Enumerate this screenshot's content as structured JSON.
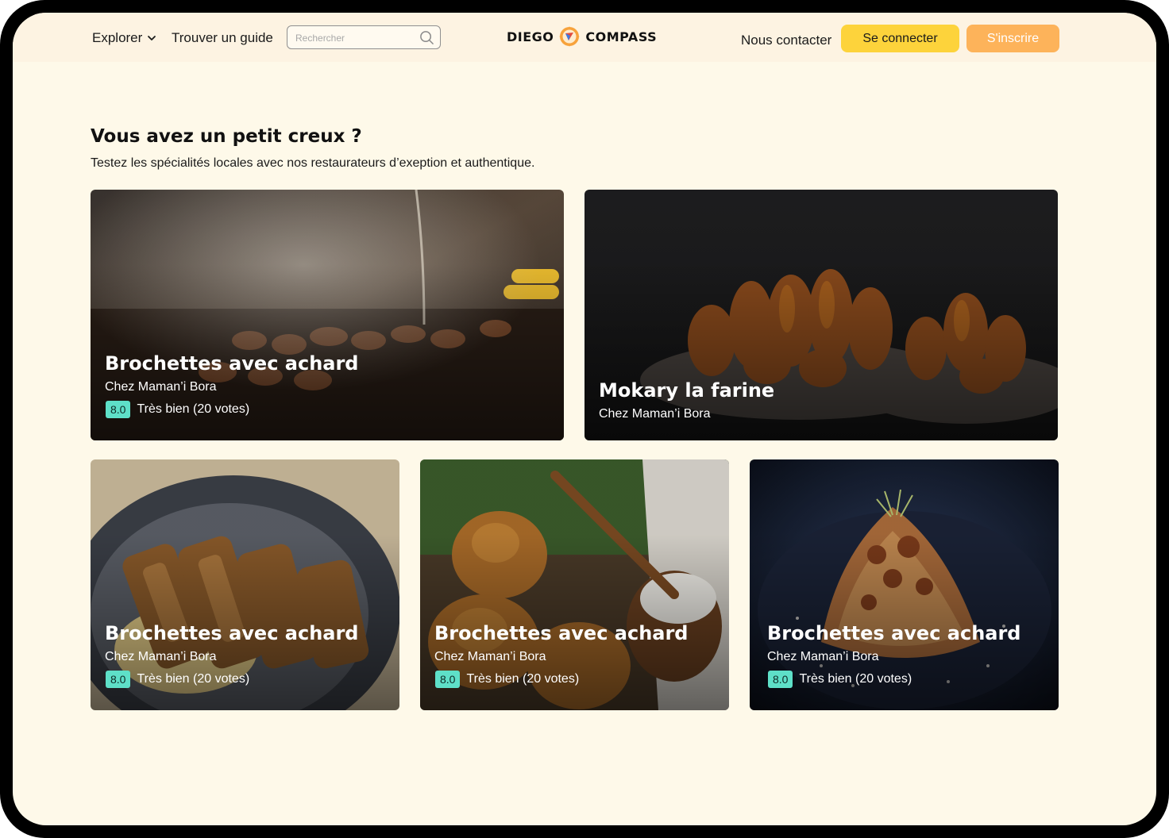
{
  "nav": {
    "explorer_label": "Explorer",
    "find_guide_label": "Trouver un guide",
    "search_placeholder": "Rechercher",
    "logo_left": "DIEGO",
    "logo_right": "COMPASS",
    "contact_label": "Nous contacter",
    "login_label": "Se connecter",
    "signup_label": "S'inscrire"
  },
  "section": {
    "title": "Vous avez un petit creux ?",
    "subtitle": "Testez les spécialités locales avec nos restaurateurs d’exeption et authentique."
  },
  "cards": [
    {
      "title": "Brochettes avec achard",
      "place": "Chez Maman’i Bora",
      "score": "8.0",
      "rating_text": "Très bien (20 votes)",
      "image": "grilled-skewers-photo"
    },
    {
      "title": "Mokary la farine",
      "place": "Chez Maman’i Bora",
      "image": "fried-dough-photo"
    },
    {
      "title": "Brochettes avec achard",
      "place": "Chez Maman’i Bora",
      "score": "8.0",
      "rating_text": "Très bien (20 votes)",
      "image": "breaded-cutlet-rice-photo"
    },
    {
      "title": "Brochettes avec achard",
      "place": "Chez Maman’i Bora",
      "score": "8.0",
      "rating_text": "Très bien (20 votes)",
      "image": "fritters-photo"
    },
    {
      "title": "Brochettes avec achard",
      "place": "Chez Maman’i Bora",
      "score": "8.0",
      "rating_text": "Très bien (20 votes)",
      "image": "pasta-bolognese-photo"
    }
  ],
  "colors": {
    "background": "#fef9e9",
    "navbar": "#fdf3e2",
    "login_button": "#fdd33b",
    "signup_button": "#fdb35a",
    "score_badge": "#5ee0c8"
  }
}
